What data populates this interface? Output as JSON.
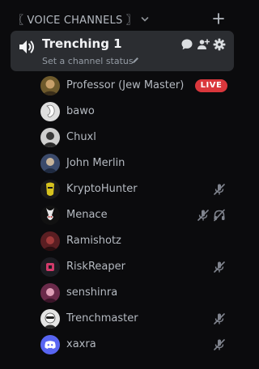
{
  "section": {
    "title": "〖 VOICE CHANNELS 〗"
  },
  "channel": {
    "name": "Trenching 1",
    "status_placeholder": "Set a channel status"
  },
  "users": [
    {
      "name": "Professor (Jew Master)",
      "live": "LIVE"
    },
    {
      "name": "bawo"
    },
    {
      "name": "Chuxl"
    },
    {
      "name": "John Merlin"
    },
    {
      "name": "KryptoHunter",
      "muted": true
    },
    {
      "name": "Menace",
      "muted": true,
      "deafened": true
    },
    {
      "name": "Ramishotz"
    },
    {
      "name": "RiskReaper",
      "muted": true
    },
    {
      "name": "senshinra"
    },
    {
      "name": "Trenchmaster",
      "muted": true
    },
    {
      "name": "xaxra",
      "muted": true
    }
  ],
  "colors": {
    "background": "#0b0b0d",
    "channel_bg": "#2b2d31",
    "live_red": "#da373c",
    "discord_blurple": "#5865f2"
  }
}
